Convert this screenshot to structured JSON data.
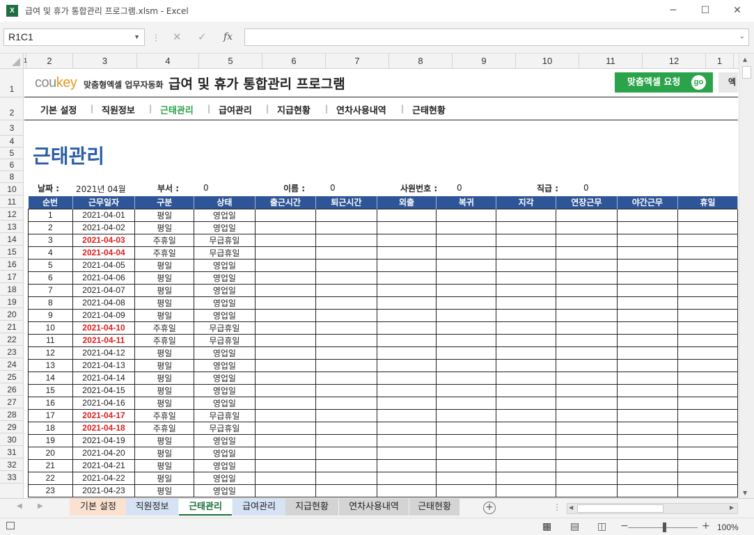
{
  "window": {
    "title": "급여 및 휴가 통합관리 프로그램.xlsm - Excel",
    "app_icon": "X"
  },
  "formula_bar": {
    "name_box": "R1C1",
    "formula": "",
    "fx": "fx",
    "cancel": "✕",
    "enter": "✓"
  },
  "columns": [
    "1",
    "2",
    "3",
    "4",
    "5",
    "6",
    "7",
    "8",
    "9",
    "10",
    "11",
    "12",
    "1"
  ],
  "rows": [
    "1",
    "2",
    "3",
    "4",
    "5",
    "6",
    "8",
    "10",
    "11",
    "12",
    "13",
    "14",
    "15",
    "16",
    "17",
    "18",
    "19",
    "20",
    "21",
    "22",
    "23",
    "24",
    "25",
    "26",
    "27",
    "28",
    "29",
    "30",
    "31",
    "32",
    "33"
  ],
  "header": {
    "logo_main": "cou",
    "logo_accent": "key",
    "logo_sub": "맞춤형엑셀 업무자동화",
    "program_title": "급여 및 휴가 통합관리 프로그램",
    "request_button": "맞춤엑셀 요청",
    "go_label": "go",
    "extra_button": "엑"
  },
  "nav": [
    "기본 설정",
    "직원정보",
    "근태관리",
    "급여관리",
    "지급현황",
    "연차사용내역",
    "근태현황"
  ],
  "nav_active": 2,
  "page_title": "근태관리",
  "info": {
    "date_label": "날짜 :",
    "date_value": "2021년 04월",
    "dept_label": "부서 :",
    "dept_value": "0",
    "name_label": "이름 :",
    "name_value": "0",
    "empno_label": "사원번호 :",
    "empno_value": "0",
    "rank_label": "직급 :",
    "rank_value": "0"
  },
  "table": {
    "headers": [
      "순번",
      "근무일자",
      "구분",
      "상태",
      "출근시간",
      "퇴근시간",
      "외출",
      "복귀",
      "지각",
      "연장근무",
      "야간근무",
      "휴일"
    ],
    "rows": [
      [
        "1",
        "2021-04-01",
        "평일",
        "영업일",
        false
      ],
      [
        "2",
        "2021-04-02",
        "평일",
        "영업일",
        false
      ],
      [
        "3",
        "2021-04-03",
        "주휴일",
        "무급휴일",
        true
      ],
      [
        "4",
        "2021-04-04",
        "주휴일",
        "무급휴일",
        true
      ],
      [
        "5",
        "2021-04-05",
        "평일",
        "영업일",
        false
      ],
      [
        "6",
        "2021-04-06",
        "평일",
        "영업일",
        false
      ],
      [
        "7",
        "2021-04-07",
        "평일",
        "영업일",
        false
      ],
      [
        "8",
        "2021-04-08",
        "평일",
        "영업일",
        false
      ],
      [
        "9",
        "2021-04-09",
        "평일",
        "영업일",
        false
      ],
      [
        "10",
        "2021-04-10",
        "주휴일",
        "무급휴일",
        true
      ],
      [
        "11",
        "2021-04-11",
        "주휴일",
        "무급휴일",
        true
      ],
      [
        "12",
        "2021-04-12",
        "평일",
        "영업일",
        false
      ],
      [
        "13",
        "2021-04-13",
        "평일",
        "영업일",
        false
      ],
      [
        "14",
        "2021-04-14",
        "평일",
        "영업일",
        false
      ],
      [
        "15",
        "2021-04-15",
        "평일",
        "영업일",
        false
      ],
      [
        "16",
        "2021-04-16",
        "평일",
        "영업일",
        false
      ],
      [
        "17",
        "2021-04-17",
        "주휴일",
        "무급휴일",
        true
      ],
      [
        "18",
        "2021-04-18",
        "주휴일",
        "무급휴일",
        true
      ],
      [
        "19",
        "2021-04-19",
        "평일",
        "영업일",
        false
      ],
      [
        "20",
        "2021-04-20",
        "평일",
        "영업일",
        false
      ],
      [
        "21",
        "2021-04-21",
        "평일",
        "영업일",
        false
      ],
      [
        "22",
        "2021-04-22",
        "평일",
        "영업일",
        false
      ],
      [
        "23",
        "2021-04-23",
        "평일",
        "영업일",
        false
      ]
    ]
  },
  "sheet_tabs": [
    {
      "label": "기본 설정",
      "color": "#fbe1cf"
    },
    {
      "label": "직원정보",
      "color": "#d6e3f5"
    },
    {
      "label": "근태관리",
      "color": "#ffffff"
    },
    {
      "label": "급여관리",
      "color": "#d6e3f5"
    },
    {
      "label": "지급현황",
      "color": "#d4d4d4"
    },
    {
      "label": "연차사용내역",
      "color": "#d4d4d4"
    },
    {
      "label": "근태현황",
      "color": "#d4d4d4"
    }
  ],
  "active_tab": 2,
  "status": {
    "zoom": "100%"
  },
  "colors": {
    "accent": "#2e5597",
    "green": "#2aa34a",
    "holiday": "#e01e1e",
    "title_blue": "#2c5da8"
  }
}
